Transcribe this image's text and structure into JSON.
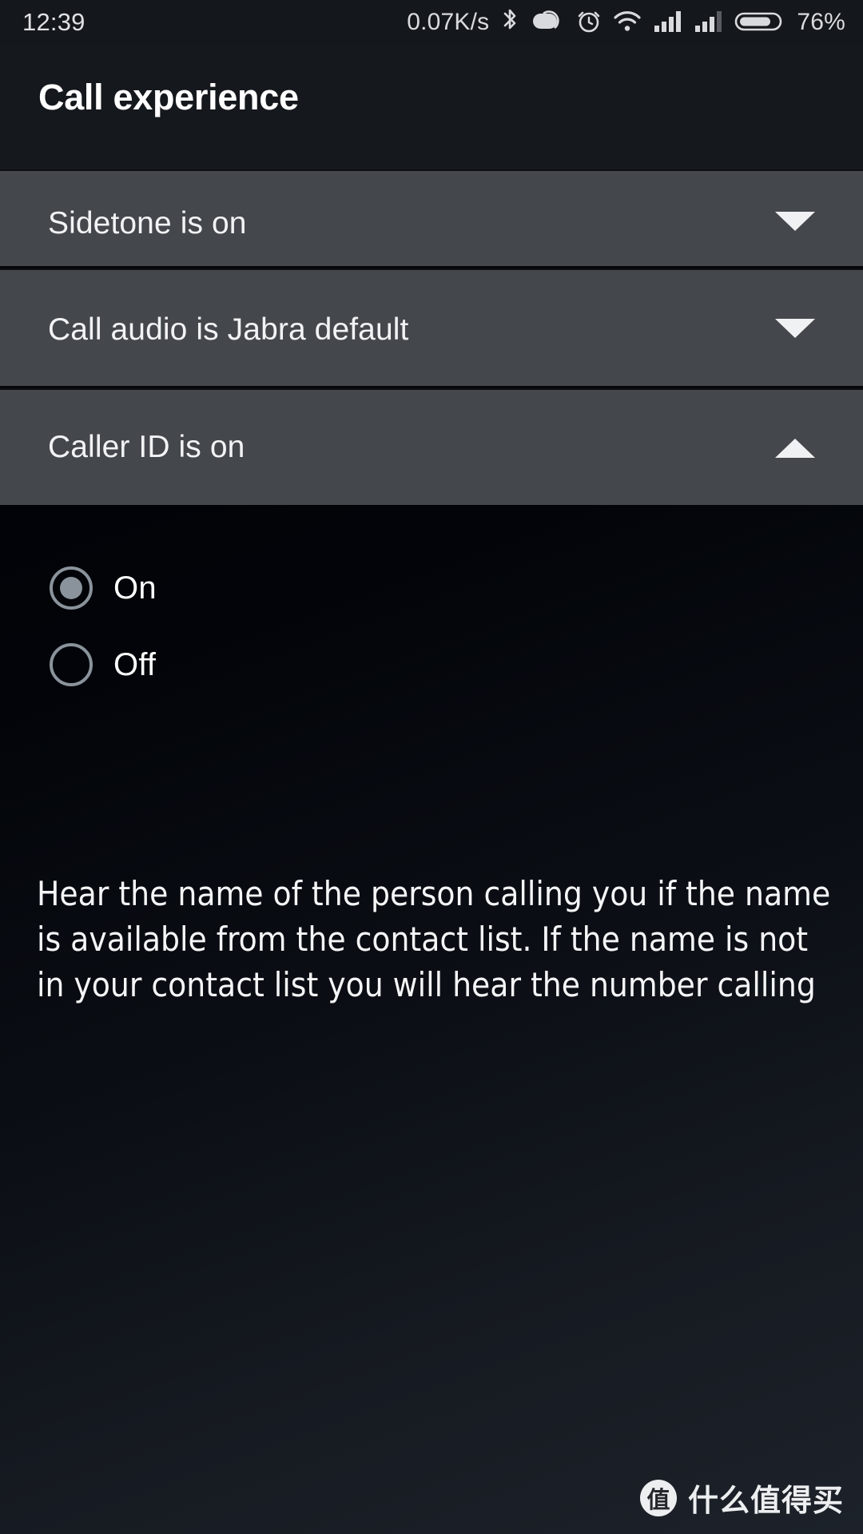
{
  "status_bar": {
    "time": "12:39",
    "network_speed": "0.07K/s",
    "battery_percent": "76%",
    "icons": [
      "bluetooth-icon",
      "vpn-capsule-icon",
      "alarm-clock-icon",
      "wifi-icon",
      "signal-bars-sim1-icon",
      "signal-bars-sim2-icon",
      "battery-icon"
    ]
  },
  "header": {
    "title": "Call experience"
  },
  "settings_rows": [
    {
      "label": "Sidetone is on",
      "caret": "chevron-down-icon",
      "expanded": false
    },
    {
      "label": "Call audio is Jabra default",
      "caret": "chevron-down-icon",
      "expanded": false
    },
    {
      "label": "Caller ID is on",
      "caret": "chevron-up-icon",
      "expanded": true
    }
  ],
  "options": [
    {
      "label": "On",
      "selected": true
    },
    {
      "label": "Off",
      "selected": false
    }
  ],
  "description": "Hear the name of the person calling you if the name is available from the contact list. If the name is not in your contact list you will hear the number calling",
  "watermark": {
    "badge": "值",
    "text": "什么值得买"
  },
  "colors": {
    "row_background": "#44484d",
    "row_divider": "#05070a",
    "status_bar_background": "#14171b",
    "title_bar_background": "#15181c",
    "radio_accent": "#8a939b",
    "text_primary": "#ffffff"
  }
}
